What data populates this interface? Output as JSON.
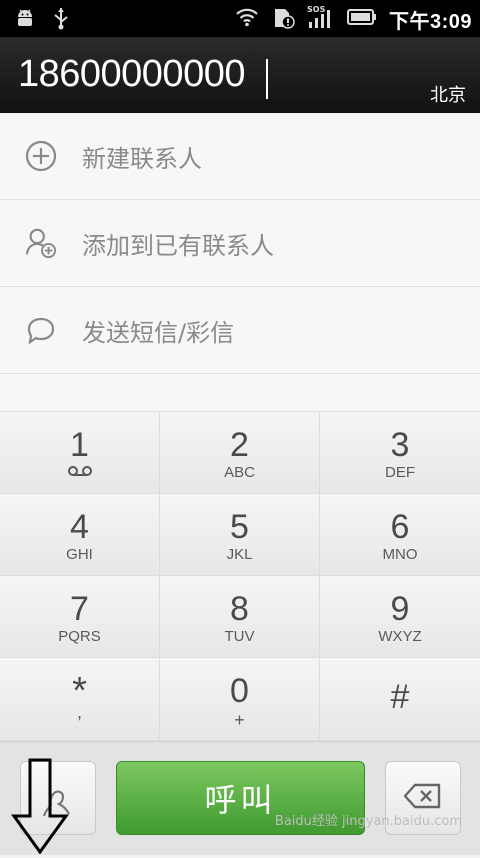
{
  "status_bar": {
    "left_icons": [
      "android-debug-icon",
      "usb-icon"
    ],
    "right_icons": [
      "wifi-icon",
      "sd-card-alert-icon",
      "signal-sos-icon",
      "battery-icon"
    ],
    "time": "下午3:09"
  },
  "dialer": {
    "number": "18600000000",
    "location": "北京"
  },
  "actions": [
    {
      "label": "新建联系人",
      "icon": "add-circle-icon"
    },
    {
      "label": "添加到已有联系人",
      "icon": "add-to-contact-icon"
    },
    {
      "label": "发送短信/彩信",
      "icon": "message-bubble-icon"
    }
  ],
  "keypad": [
    {
      "digit": "1",
      "letters": "ꝏ"
    },
    {
      "digit": "2",
      "letters": "ABC"
    },
    {
      "digit": "3",
      "letters": "DEF"
    },
    {
      "digit": "4",
      "letters": "GHI"
    },
    {
      "digit": "5",
      "letters": "JKL"
    },
    {
      "digit": "6",
      "letters": "MNO"
    },
    {
      "digit": "7",
      "letters": "PQRS"
    },
    {
      "digit": "8",
      "letters": "TUV"
    },
    {
      "digit": "9",
      "letters": "WXYZ"
    },
    {
      "digit": "*",
      "letters": ","
    },
    {
      "digit": "0",
      "letters": "+"
    },
    {
      "digit": "#",
      "letters": ""
    }
  ],
  "bottom": {
    "call_label": "呼叫",
    "watermark": "Baidu经验 jingyan.baidu.com"
  },
  "colors": {
    "call_green": "#4fae3b",
    "status_bg": "#000000",
    "number_bg": "#1a1a1a"
  }
}
